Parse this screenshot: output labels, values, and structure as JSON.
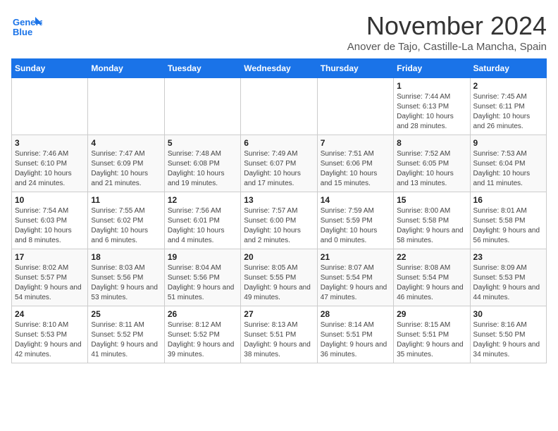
{
  "logo": {
    "line1": "General",
    "line2": "Blue"
  },
  "title": "November 2024",
  "location": "Anover de Tajo, Castille-La Mancha, Spain",
  "weekdays": [
    "Sunday",
    "Monday",
    "Tuesday",
    "Wednesday",
    "Thursday",
    "Friday",
    "Saturday"
  ],
  "weeks": [
    [
      {
        "day": "",
        "info": ""
      },
      {
        "day": "",
        "info": ""
      },
      {
        "day": "",
        "info": ""
      },
      {
        "day": "",
        "info": ""
      },
      {
        "day": "",
        "info": ""
      },
      {
        "day": "1",
        "info": "Sunrise: 7:44 AM\nSunset: 6:13 PM\nDaylight: 10 hours and 28 minutes."
      },
      {
        "day": "2",
        "info": "Sunrise: 7:45 AM\nSunset: 6:11 PM\nDaylight: 10 hours and 26 minutes."
      }
    ],
    [
      {
        "day": "3",
        "info": "Sunrise: 7:46 AM\nSunset: 6:10 PM\nDaylight: 10 hours and 24 minutes."
      },
      {
        "day": "4",
        "info": "Sunrise: 7:47 AM\nSunset: 6:09 PM\nDaylight: 10 hours and 21 minutes."
      },
      {
        "day": "5",
        "info": "Sunrise: 7:48 AM\nSunset: 6:08 PM\nDaylight: 10 hours and 19 minutes."
      },
      {
        "day": "6",
        "info": "Sunrise: 7:49 AM\nSunset: 6:07 PM\nDaylight: 10 hours and 17 minutes."
      },
      {
        "day": "7",
        "info": "Sunrise: 7:51 AM\nSunset: 6:06 PM\nDaylight: 10 hours and 15 minutes."
      },
      {
        "day": "8",
        "info": "Sunrise: 7:52 AM\nSunset: 6:05 PM\nDaylight: 10 hours and 13 minutes."
      },
      {
        "day": "9",
        "info": "Sunrise: 7:53 AM\nSunset: 6:04 PM\nDaylight: 10 hours and 11 minutes."
      }
    ],
    [
      {
        "day": "10",
        "info": "Sunrise: 7:54 AM\nSunset: 6:03 PM\nDaylight: 10 hours and 8 minutes."
      },
      {
        "day": "11",
        "info": "Sunrise: 7:55 AM\nSunset: 6:02 PM\nDaylight: 10 hours and 6 minutes."
      },
      {
        "day": "12",
        "info": "Sunrise: 7:56 AM\nSunset: 6:01 PM\nDaylight: 10 hours and 4 minutes."
      },
      {
        "day": "13",
        "info": "Sunrise: 7:57 AM\nSunset: 6:00 PM\nDaylight: 10 hours and 2 minutes."
      },
      {
        "day": "14",
        "info": "Sunrise: 7:59 AM\nSunset: 5:59 PM\nDaylight: 10 hours and 0 minutes."
      },
      {
        "day": "15",
        "info": "Sunrise: 8:00 AM\nSunset: 5:58 PM\nDaylight: 9 hours and 58 minutes."
      },
      {
        "day": "16",
        "info": "Sunrise: 8:01 AM\nSunset: 5:58 PM\nDaylight: 9 hours and 56 minutes."
      }
    ],
    [
      {
        "day": "17",
        "info": "Sunrise: 8:02 AM\nSunset: 5:57 PM\nDaylight: 9 hours and 54 minutes."
      },
      {
        "day": "18",
        "info": "Sunrise: 8:03 AM\nSunset: 5:56 PM\nDaylight: 9 hours and 53 minutes."
      },
      {
        "day": "19",
        "info": "Sunrise: 8:04 AM\nSunset: 5:56 PM\nDaylight: 9 hours and 51 minutes."
      },
      {
        "day": "20",
        "info": "Sunrise: 8:05 AM\nSunset: 5:55 PM\nDaylight: 9 hours and 49 minutes."
      },
      {
        "day": "21",
        "info": "Sunrise: 8:07 AM\nSunset: 5:54 PM\nDaylight: 9 hours and 47 minutes."
      },
      {
        "day": "22",
        "info": "Sunrise: 8:08 AM\nSunset: 5:54 PM\nDaylight: 9 hours and 46 minutes."
      },
      {
        "day": "23",
        "info": "Sunrise: 8:09 AM\nSunset: 5:53 PM\nDaylight: 9 hours and 44 minutes."
      }
    ],
    [
      {
        "day": "24",
        "info": "Sunrise: 8:10 AM\nSunset: 5:53 PM\nDaylight: 9 hours and 42 minutes."
      },
      {
        "day": "25",
        "info": "Sunrise: 8:11 AM\nSunset: 5:52 PM\nDaylight: 9 hours and 41 minutes."
      },
      {
        "day": "26",
        "info": "Sunrise: 8:12 AM\nSunset: 5:52 PM\nDaylight: 9 hours and 39 minutes."
      },
      {
        "day": "27",
        "info": "Sunrise: 8:13 AM\nSunset: 5:51 PM\nDaylight: 9 hours and 38 minutes."
      },
      {
        "day": "28",
        "info": "Sunrise: 8:14 AM\nSunset: 5:51 PM\nDaylight: 9 hours and 36 minutes."
      },
      {
        "day": "29",
        "info": "Sunrise: 8:15 AM\nSunset: 5:51 PM\nDaylight: 9 hours and 35 minutes."
      },
      {
        "day": "30",
        "info": "Sunrise: 8:16 AM\nSunset: 5:50 PM\nDaylight: 9 hours and 34 minutes."
      }
    ]
  ]
}
